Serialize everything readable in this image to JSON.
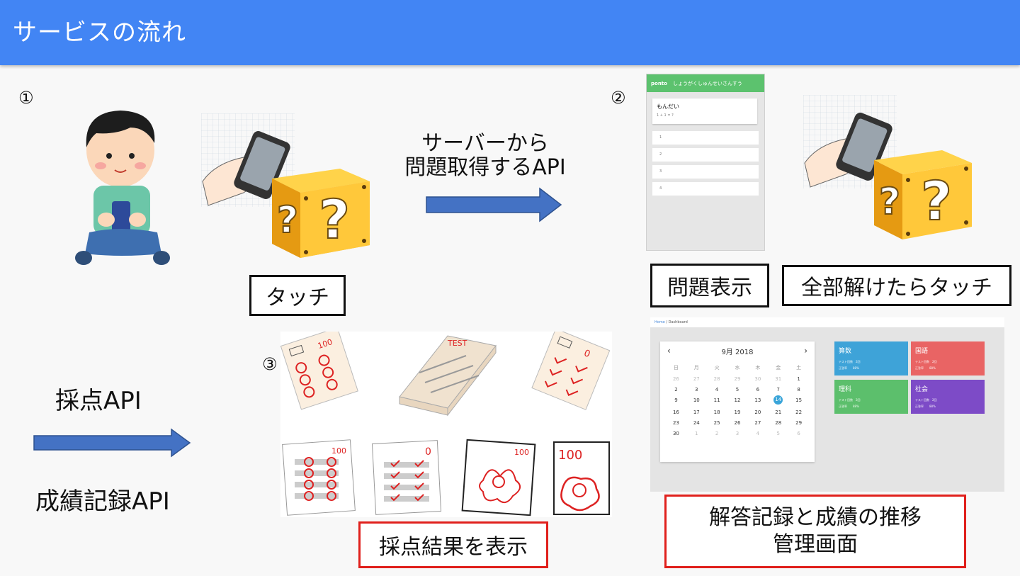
{
  "header": {
    "title": "サービスの流れ"
  },
  "steps": {
    "one": "①",
    "two": "②",
    "three": "③"
  },
  "labels": {
    "server_api_line1": "サーバーから",
    "server_api_line2": "問題取得するAPI",
    "touch": "タッチ",
    "show_question": "問題表示",
    "touch_after_solve": "全部解けたらタッチ",
    "grading_api": "採点API",
    "record_api": "成績記録API",
    "show_result": "採点結果を表示",
    "mgmt_line1": "解答記録と成績の推移",
    "mgmt_line2": "管理画面"
  },
  "phone": {
    "brand": "ponto",
    "user": "しょうがくしゅんせいさんすう",
    "question_title": "もんだい",
    "question_sub": "1 + 1 = ?",
    "options": [
      "1",
      "2",
      "3",
      "4"
    ]
  },
  "dashboard": {
    "crumb_home": "Home",
    "crumb_page": "Dashboard",
    "calendar": {
      "month": "9月 2018",
      "weekdays": [
        "日",
        "月",
        "火",
        "水",
        "木",
        "金",
        "土"
      ],
      "days": [
        [
          "26",
          "27",
          "28",
          "29",
          "30",
          "31",
          "1"
        ],
        [
          "2",
          "3",
          "4",
          "5",
          "6",
          "7",
          "8"
        ],
        [
          "9",
          "10",
          "11",
          "12",
          "13",
          "14",
          "15"
        ],
        [
          "16",
          "17",
          "18",
          "19",
          "20",
          "21",
          "22"
        ],
        [
          "23",
          "24",
          "25",
          "26",
          "27",
          "28",
          "29"
        ],
        [
          "30",
          "1",
          "2",
          "3",
          "4",
          "5",
          "6"
        ]
      ],
      "today": "14"
    },
    "tiles": [
      {
        "name": "算数",
        "line1": "テスト回数　2回",
        "line2": "正答率　　88%",
        "color": "#3ea3d8"
      },
      {
        "name": "国語",
        "line1": "テスト回数　2回",
        "line2": "正答率　　88%",
        "color": "#e96464"
      },
      {
        "name": "理科",
        "line1": "テスト回数　2回",
        "line2": "正答率　　88%",
        "color": "#5cbf6c"
      },
      {
        "name": "社会",
        "line1": "テスト回数　2回",
        "line2": "正答率　　88%",
        "color": "#7d4bc7"
      }
    ]
  },
  "illustrations": {
    "test_stack_label": "TEST",
    "score_100": "100",
    "score_0": "0"
  },
  "colors": {
    "header": "#4285f4",
    "arrow": "#4472c4",
    "red_border": "#e0201c"
  }
}
